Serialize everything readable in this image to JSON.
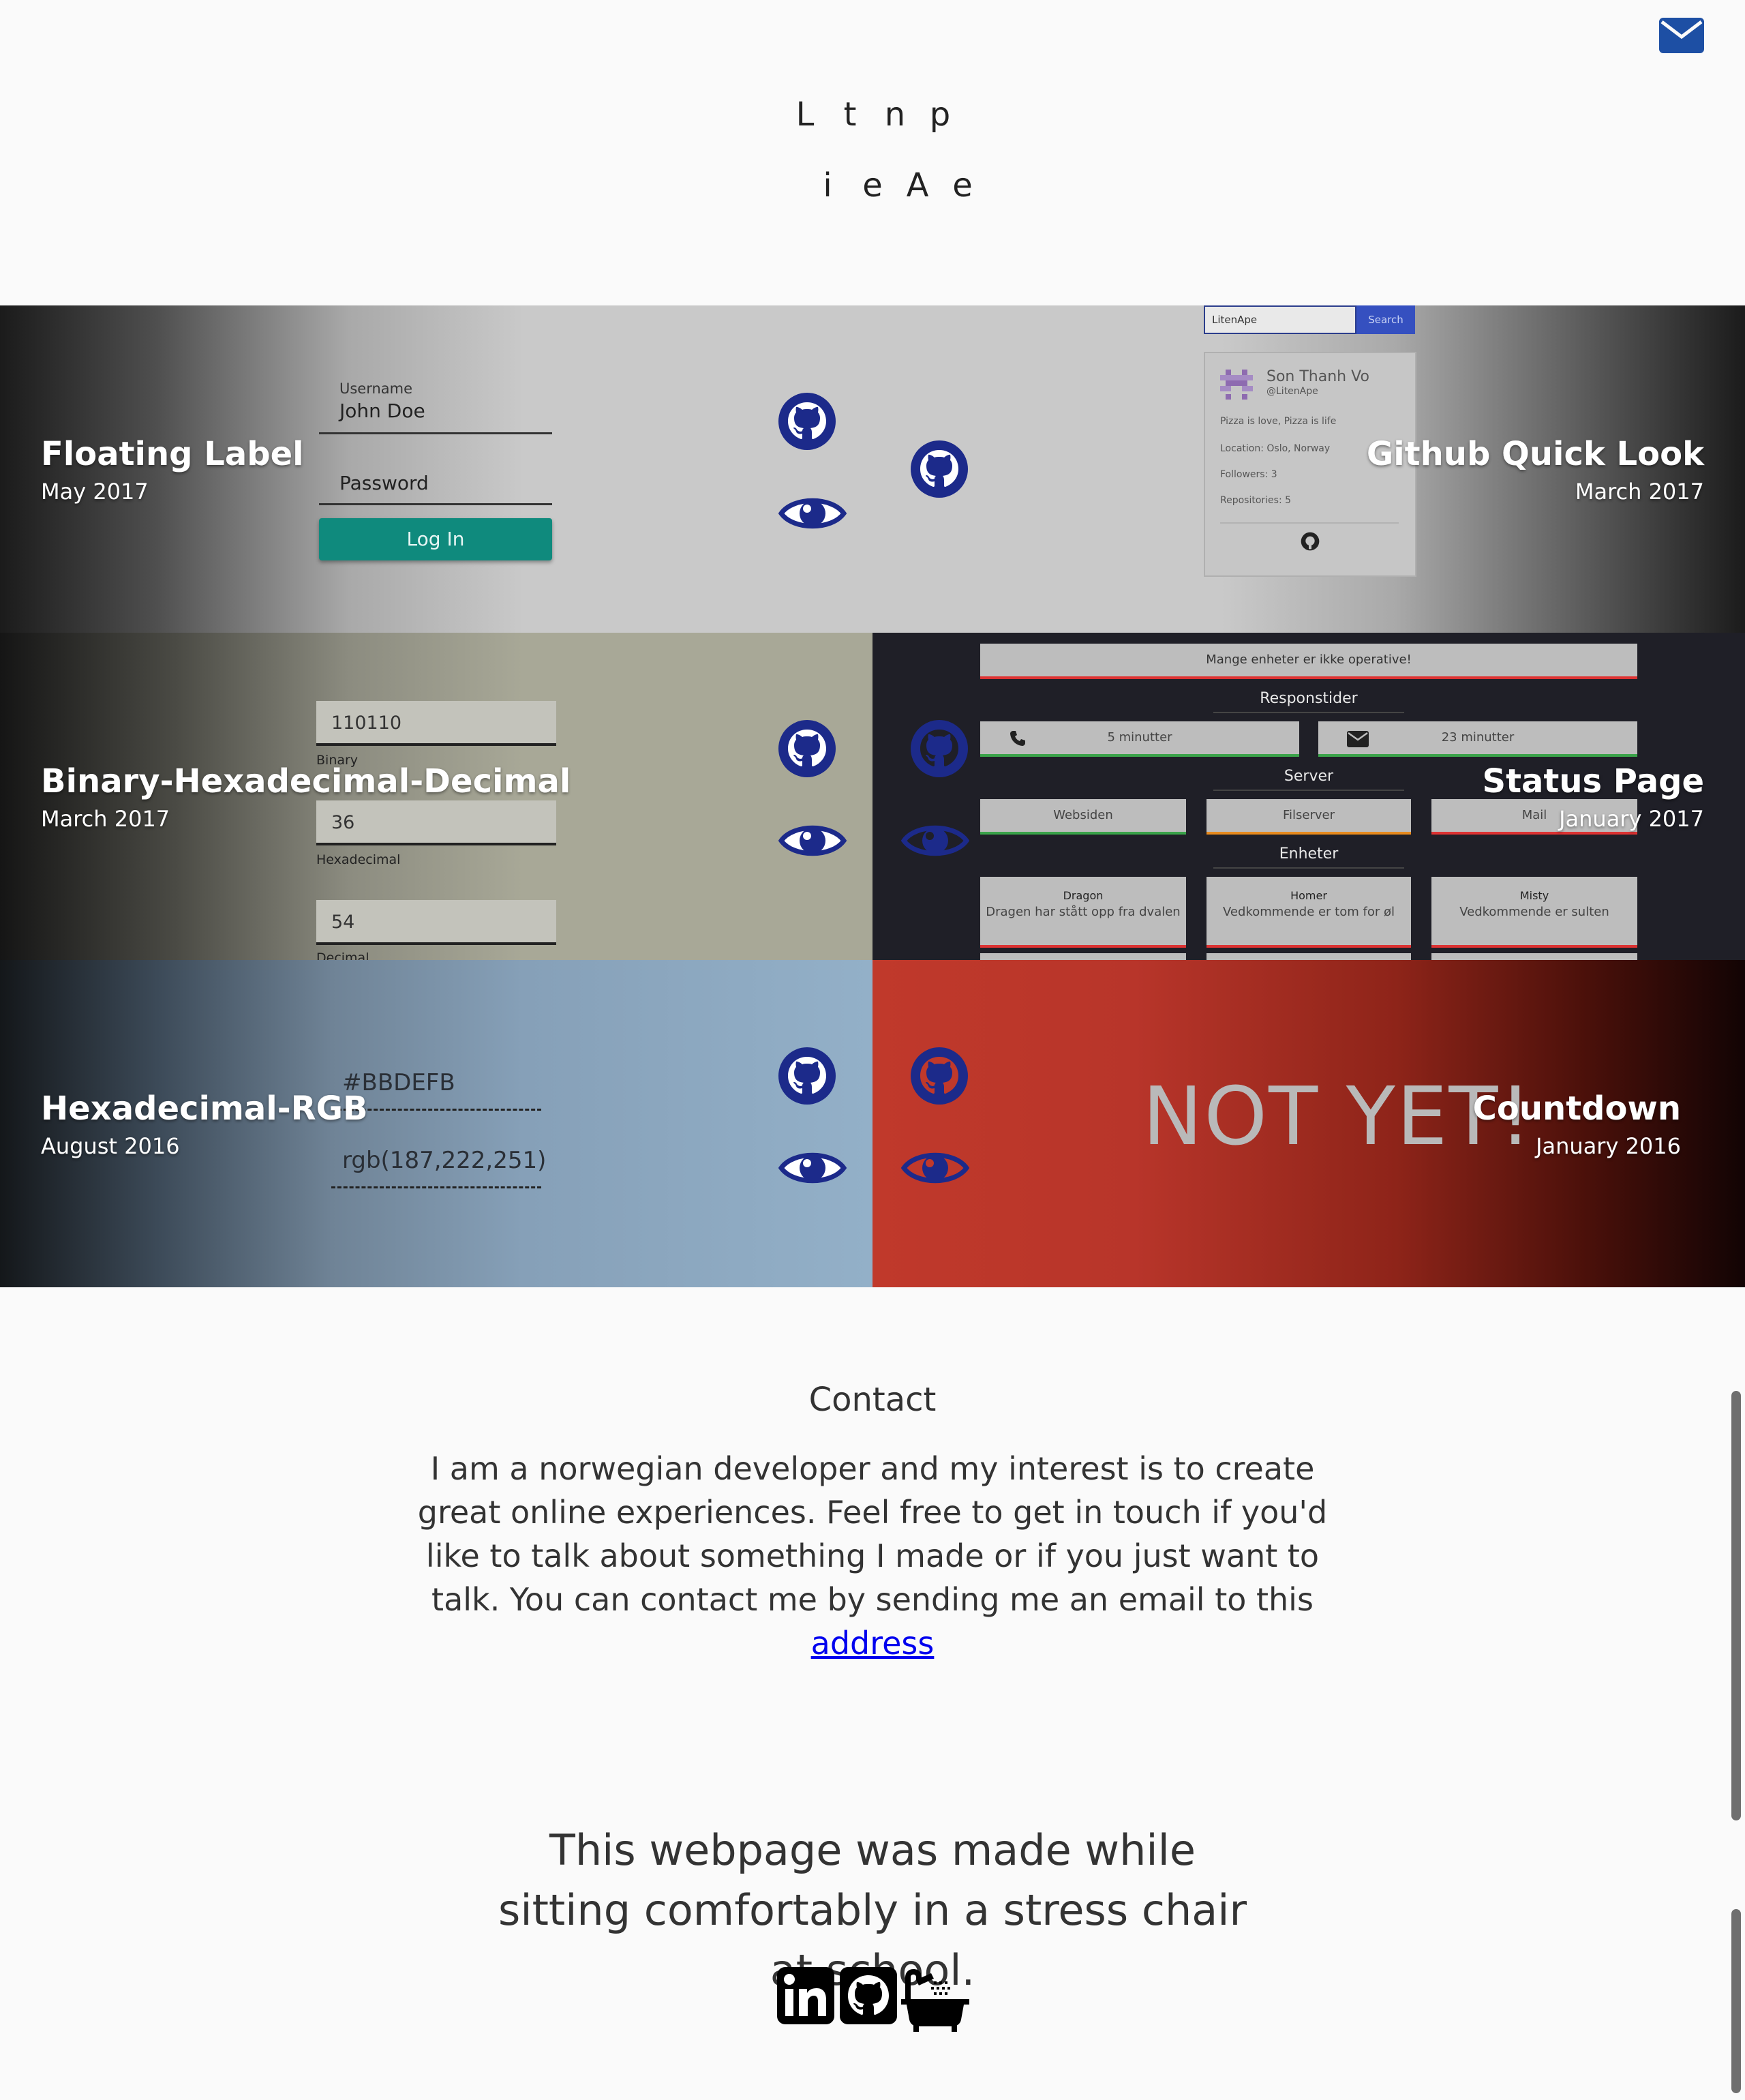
{
  "header": {
    "mail_icon": "envelope-icon",
    "logo_top": [
      "L",
      "t",
      "n",
      "p"
    ],
    "logo_bottom": [
      "i",
      "e",
      "A",
      "e"
    ]
  },
  "projects": [
    {
      "title": "Floating Label",
      "date": "May 2017",
      "github_icon": "github-icon",
      "view_icon": "eye-icon"
    },
    {
      "title": "Github Quick Look",
      "date": "March 2017",
      "github_icon": "github-icon"
    },
    {
      "title": "Binary-Hexadecimal-Decimal",
      "date": "March 2017",
      "github_icon": "github-icon",
      "view_icon": "eye-icon"
    },
    {
      "title": "Status Page",
      "date": "January 2017",
      "github_icon": "github-icon",
      "view_icon": "eye-icon"
    },
    {
      "title": "Hexadecimal-RGB",
      "date": "August 2016",
      "github_icon": "github-icon",
      "view_icon": "eye-icon"
    },
    {
      "title": "Countdown",
      "date": "January 2016",
      "github_icon": "github-icon",
      "view_icon": "eye-icon"
    }
  ],
  "previews": {
    "floating_label": {
      "username_label": "Username",
      "username_value": "John Doe",
      "password_label": "Password",
      "login_button": "Log In"
    },
    "github_quick_look": {
      "search_value": "LitenApe",
      "search_button": "Search",
      "name": "Son Thanh Vo",
      "handle": "@LitenApe",
      "bio": "Pizza is love, Pizza is life",
      "location": "Location: Oslo, Norway",
      "followers": "Followers: 3",
      "repositories": "Repositories: 5"
    },
    "binary_hex_dec": {
      "binary_value": "110110",
      "binary_label": "Binary",
      "hex_value": "36",
      "hex_label": "Hexadecimal",
      "decimal_value": "54",
      "decimal_label": "Decimal"
    },
    "status_page": {
      "alert": "Mange enheter er ikke operative!",
      "section_response": "Responstider",
      "phone_time": "5 minutter",
      "mail_time": "23 minutter",
      "section_server": "Server",
      "server_items": [
        "Websiden",
        "Filserver",
        "Mail"
      ],
      "section_devices": "Enheter",
      "devices": [
        {
          "name": "Dragon",
          "status": "Dragen har stått opp fra dvalen"
        },
        {
          "name": "Homer",
          "status": "Vedkommende er tom for øl"
        },
        {
          "name": "Misty",
          "status": "Vedkommende er sulten"
        }
      ]
    },
    "hex_rgb": {
      "hex_value": "#BBDEFB",
      "rgb_value": "rgb(187,222,251)"
    },
    "countdown": {
      "text": "NOT YET!"
    }
  },
  "contact": {
    "title": "Contact",
    "text": "I am a norwegian developer and my interest is to create great online experiences. Feel free to get in touch if you'd like to talk about something I made or if you just want to talk. You can contact me by sending me an email to this",
    "link": "address"
  },
  "footer": {
    "text": "This webpage was made while sitting comfortably in a stress chair at school.",
    "icons": [
      "linkedin-icon",
      "github-icon",
      "bathtub-icon"
    ]
  }
}
